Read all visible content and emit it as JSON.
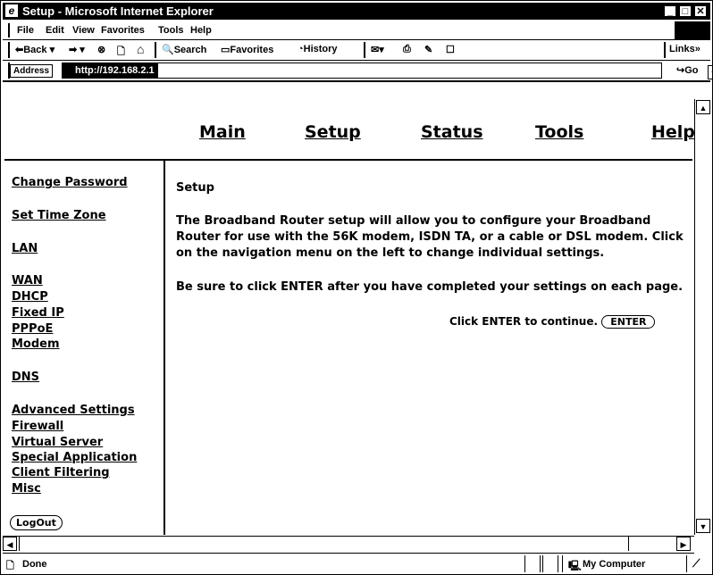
{
  "window": {
    "title": "Setup - Microsoft Internet Explorer"
  },
  "menubar": {
    "items": [
      "File",
      "Edit",
      "View",
      "Favorites",
      "Tools",
      "Help"
    ]
  },
  "toolbar": {
    "back": "Back",
    "search": "Search",
    "favorites": "Favorites",
    "history": "History",
    "links": "Links"
  },
  "address": {
    "label": "Address",
    "url": "http://192.168.2.1",
    "go": "Go"
  },
  "topnav": {
    "items": [
      "Main",
      "Setup",
      "Status",
      "Tools",
      "Help"
    ]
  },
  "sidebar": {
    "items": [
      "Change Password",
      "Set Time Zone",
      "LAN",
      "WAN",
      "DHCP",
      "Fixed IP",
      "PPPoE",
      "Modem",
      "DNS",
      "Advanced Settings",
      "Firewall",
      "Virtual Server",
      "Special Application",
      "Client Filtering",
      "Misc"
    ],
    "logout": "LogOut"
  },
  "main": {
    "heading": "Setup",
    "paragraph1": "The Broadband Router setup will allow you to configure your Broadband Router for use with the 56K modem, ISDN TA, or a cable or DSL modem. Click on the navigation menu on the left to change individual settings.",
    "paragraph2": "Be sure to click ENTER after you have completed your settings on each page.",
    "continue_text": "Click ENTER to continue.",
    "enter_label": "ENTER"
  },
  "statusbar": {
    "text": "Done",
    "zone": "My Computer"
  },
  "icons": [
    "ie-logo-icon",
    "back-arrow-icon",
    "forward-arrow-icon",
    "stop-icon",
    "refresh-icon",
    "home-icon",
    "search-icon",
    "favorites-folder-icon",
    "history-icon",
    "mail-icon",
    "print-icon",
    "edit-icon",
    "discuss-icon",
    "go-icon",
    "page-icon",
    "computer-icon"
  ]
}
